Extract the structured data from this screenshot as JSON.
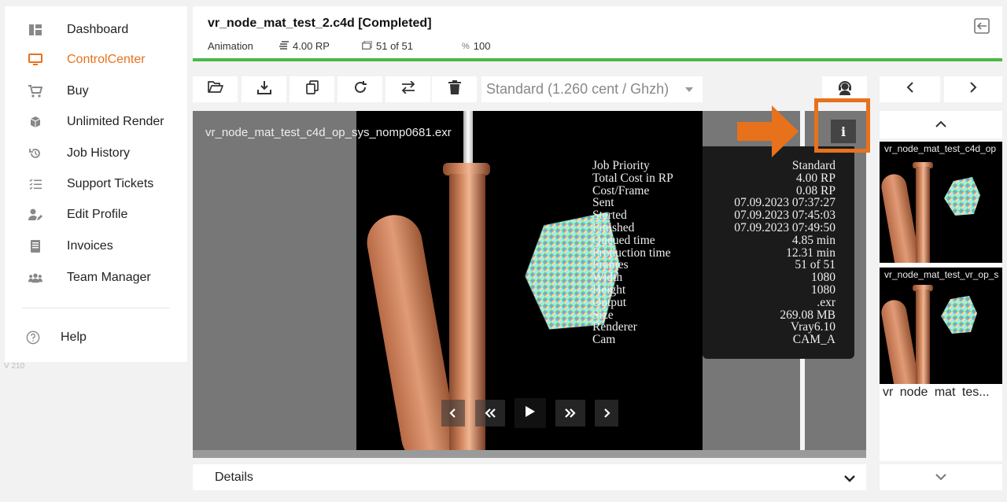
{
  "sidebar": {
    "items": [
      {
        "label": "Dashboard",
        "icon": "dashboard-icon"
      },
      {
        "label": "ControlCenter",
        "icon": "monitor-icon",
        "active": true
      },
      {
        "label": "Buy",
        "icon": "cart-icon"
      },
      {
        "label": "Unlimited Render",
        "icon": "cube-icon"
      },
      {
        "label": "Job History",
        "icon": "history-icon"
      },
      {
        "label": "Support Tickets",
        "icon": "checklist-icon"
      },
      {
        "label": "Edit Profile",
        "icon": "user-edit-icon"
      },
      {
        "label": "Invoices",
        "icon": "invoice-icon"
      },
      {
        "label": "Team Manager",
        "icon": "team-icon"
      }
    ],
    "help_label": "Help",
    "version": "V 210"
  },
  "header": {
    "title": "vr_node_mat_test_2.c4d [Completed]",
    "type": "Animation",
    "cost": "4.00 RP",
    "frames": "51 of 51",
    "percent": "100",
    "progress_percent": 100
  },
  "toolbar": {
    "buttons": [
      "open-folder-icon",
      "download-icon",
      "copy-icon",
      "restart-icon",
      "swap-icon",
      "trash-icon"
    ],
    "price_select": "Standard (1.260 cent / Ghzh)"
  },
  "viewer": {
    "filename": "vr_node_mat_test_c4d_op_sys_nomp0681.exr",
    "info_button": "i",
    "info": [
      {
        "label": "Job Priority",
        "value": "Standard"
      },
      {
        "label": "Total Cost in RP",
        "value": "4.00 RP"
      },
      {
        "label": "Cost/Frame",
        "value": "0.08 RP"
      },
      {
        "label": "Sent",
        "value": "07.09.2023 07:37:27"
      },
      {
        "label": "Started",
        "value": "07.09.2023 07:45:03"
      },
      {
        "label": "Finished",
        "value": "07.09.2023 07:49:50"
      },
      {
        "label": "Queued time",
        "value": "4.85 min"
      },
      {
        "label": "Production time",
        "value": "12.31 min"
      },
      {
        "label": "Frames",
        "value": "51 of 51"
      },
      {
        "label": "Width",
        "value": "1080"
      },
      {
        "label": "Height",
        "value": "1080"
      },
      {
        "label": "Output",
        "value": ".exr"
      },
      {
        "label": "Size",
        "value": "269.08 MB"
      },
      {
        "label": "Renderer",
        "value": "Vray6.10"
      },
      {
        "label": "Cam",
        "value": "CAM_A"
      }
    ]
  },
  "details": {
    "label": "Details"
  },
  "thumbnails": {
    "items": [
      {
        "name": "vr_node_mat_test_c4d_op"
      },
      {
        "name": "vr_node_mat_test_vr_op_s"
      }
    ],
    "caption": "vr node mat tes..."
  },
  "colors": {
    "accent": "#e8711c",
    "progress": "#4cb848"
  }
}
